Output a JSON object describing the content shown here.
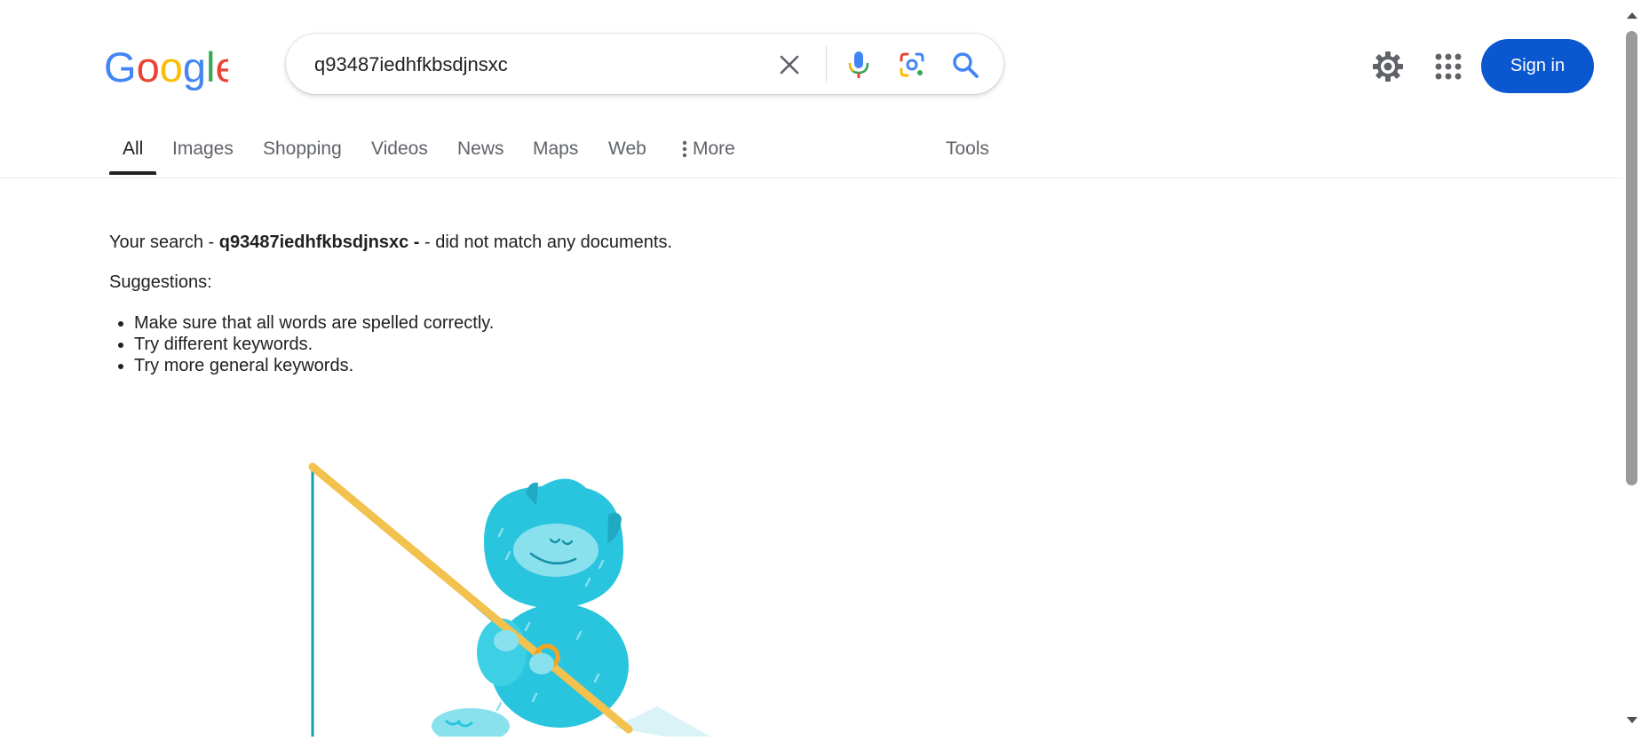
{
  "logo": {
    "text": "Google"
  },
  "search": {
    "query": "q93487iedhfkbsdjnsxc",
    "icons": [
      "close-icon",
      "mic-icon",
      "lens-icon",
      "search-icon"
    ]
  },
  "header": {
    "settings_icon": "gear-icon",
    "apps_icon": "apps-grid-icon",
    "signin_label": "Sign in"
  },
  "tabs": {
    "items": [
      {
        "label": "All",
        "active": true
      },
      {
        "label": "Images"
      },
      {
        "label": "Shopping"
      },
      {
        "label": "Videos"
      },
      {
        "label": "News"
      },
      {
        "label": "Maps"
      },
      {
        "label": "Web"
      },
      {
        "label": "More"
      }
    ],
    "tools_label": "Tools"
  },
  "results": {
    "message_prefix": "Your search - ",
    "message_query": "q93487iedhfkbsdjnsxc",
    "message_suffix": " - did not match any documents.",
    "suggestions_label": "Suggestions:",
    "suggestions": [
      "Make sure that all words are spelled correctly.",
      "Try different keywords.",
      "Try more general keywords."
    ]
  },
  "colors": {
    "brand_blue": "#4285F4",
    "brand_red": "#EA4335",
    "brand_yellow": "#FBBC05",
    "brand_green": "#34A853",
    "signin_blue": "#0b57d0",
    "character_teal": "#29c5de"
  }
}
